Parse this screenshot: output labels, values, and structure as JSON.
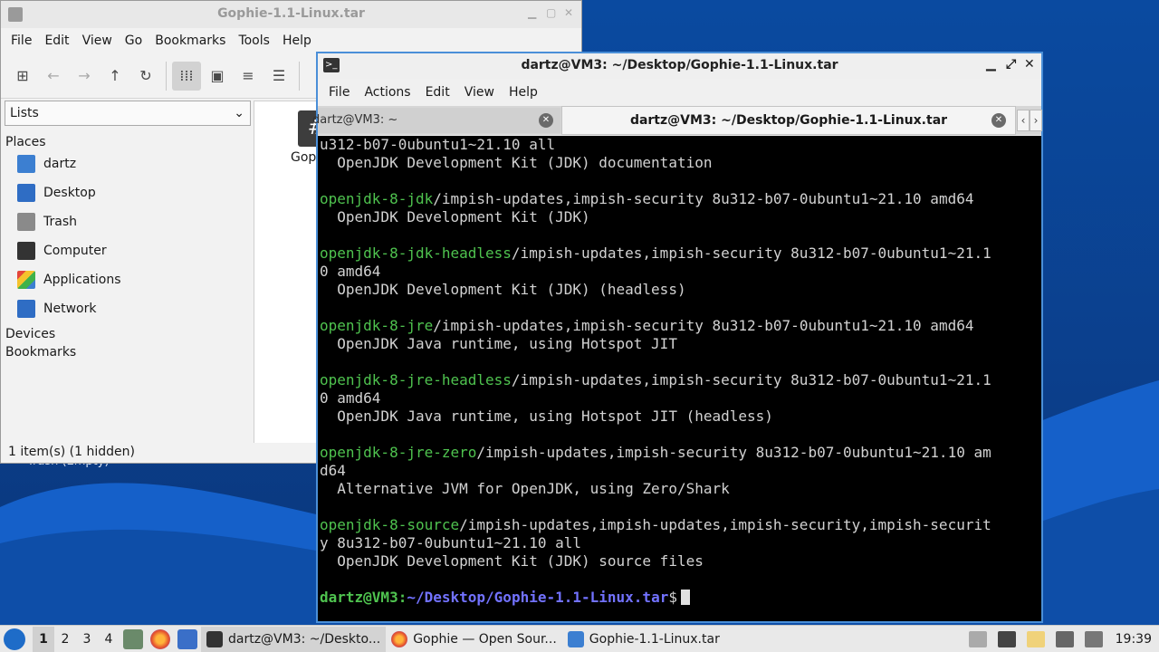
{
  "desktop": {
    "trash_label": "Trash (Empty)"
  },
  "file_manager": {
    "title": "Gophie-1.1-Linux.tar",
    "menu": [
      "File",
      "Edit",
      "View",
      "Go",
      "Bookmarks",
      "Tools",
      "Help"
    ],
    "view_select": "Lists",
    "sections": {
      "places": "Places",
      "devices": "Devices",
      "bookmarks": "Bookmarks"
    },
    "places": [
      "dartz",
      "Desktop",
      "Trash",
      "Computer",
      "Applications",
      "Network"
    ],
    "file_label": "Gop",
    "status": "1 item(s) (1 hidden)"
  },
  "terminal": {
    "title": "dartz@VM3: ~/Desktop/Gophie-1.1-Linux.tar",
    "menu": [
      "File",
      "Actions",
      "Edit",
      "View",
      "Help"
    ],
    "tabs": [
      "dartz@VM3: ~",
      "dartz@VM3: ~/Desktop/Gophie-1.1-Linux.tar"
    ],
    "lines": [
      {
        "g": "",
        "t": "u312-b07-0ubuntu1~21.10 all"
      },
      {
        "g": "",
        "t": "  OpenJDK Development Kit (JDK) documentation"
      },
      {
        "g": "",
        "t": ""
      },
      {
        "g": "openjdk-8-jdk",
        "t": "/impish-updates,impish-security 8u312-b07-0ubuntu1~21.10 amd64"
      },
      {
        "g": "",
        "t": "  OpenJDK Development Kit (JDK)"
      },
      {
        "g": "",
        "t": ""
      },
      {
        "g": "openjdk-8-jdk-headless",
        "t": "/impish-updates,impish-security 8u312-b07-0ubuntu1~21.1"
      },
      {
        "g": "",
        "t": "0 amd64"
      },
      {
        "g": "",
        "t": "  OpenJDK Development Kit (JDK) (headless)"
      },
      {
        "g": "",
        "t": ""
      },
      {
        "g": "openjdk-8-jre",
        "t": "/impish-updates,impish-security 8u312-b07-0ubuntu1~21.10 amd64"
      },
      {
        "g": "",
        "t": "  OpenJDK Java runtime, using Hotspot JIT"
      },
      {
        "g": "",
        "t": ""
      },
      {
        "g": "openjdk-8-jre-headless",
        "t": "/impish-updates,impish-security 8u312-b07-0ubuntu1~21.1"
      },
      {
        "g": "",
        "t": "0 amd64"
      },
      {
        "g": "",
        "t": "  OpenJDK Java runtime, using Hotspot JIT (headless)"
      },
      {
        "g": "",
        "t": ""
      },
      {
        "g": "openjdk-8-jre-zero",
        "t": "/impish-updates,impish-security 8u312-b07-0ubuntu1~21.10 am"
      },
      {
        "g": "",
        "t": "d64"
      },
      {
        "g": "",
        "t": "  Alternative JVM for OpenJDK, using Zero/Shark"
      },
      {
        "g": "",
        "t": ""
      },
      {
        "g": "openjdk-8-source",
        "t": "/impish-updates,impish-updates,impish-security,impish-securit"
      },
      {
        "g": "",
        "t": "y 8u312-b07-0ubuntu1~21.10 all"
      },
      {
        "g": "",
        "t": "  OpenJDK Development Kit (JDK) source files"
      },
      {
        "g": "",
        "t": ""
      }
    ],
    "prompt_user": "dartz@VM3",
    "prompt_sep": ":",
    "prompt_path": "~/Desktop/Gophie-1.1-Linux.tar",
    "prompt_end": "$"
  },
  "taskbar": {
    "workspaces": [
      "1",
      "2",
      "3",
      "4"
    ],
    "tasks": [
      {
        "label": "dartz@VM3: ~/Deskto...",
        "icon": "terminal-icon"
      },
      {
        "label": "Gophie — Open Sour...",
        "icon": "firefox-icon"
      },
      {
        "label": "Gophie-1.1-Linux.tar",
        "icon": "folder-icon"
      }
    ],
    "clock": "19:39"
  },
  "colors": {
    "accent": "#4a8fd8",
    "term_green": "#4fc34f",
    "term_blue": "#7272ff"
  }
}
